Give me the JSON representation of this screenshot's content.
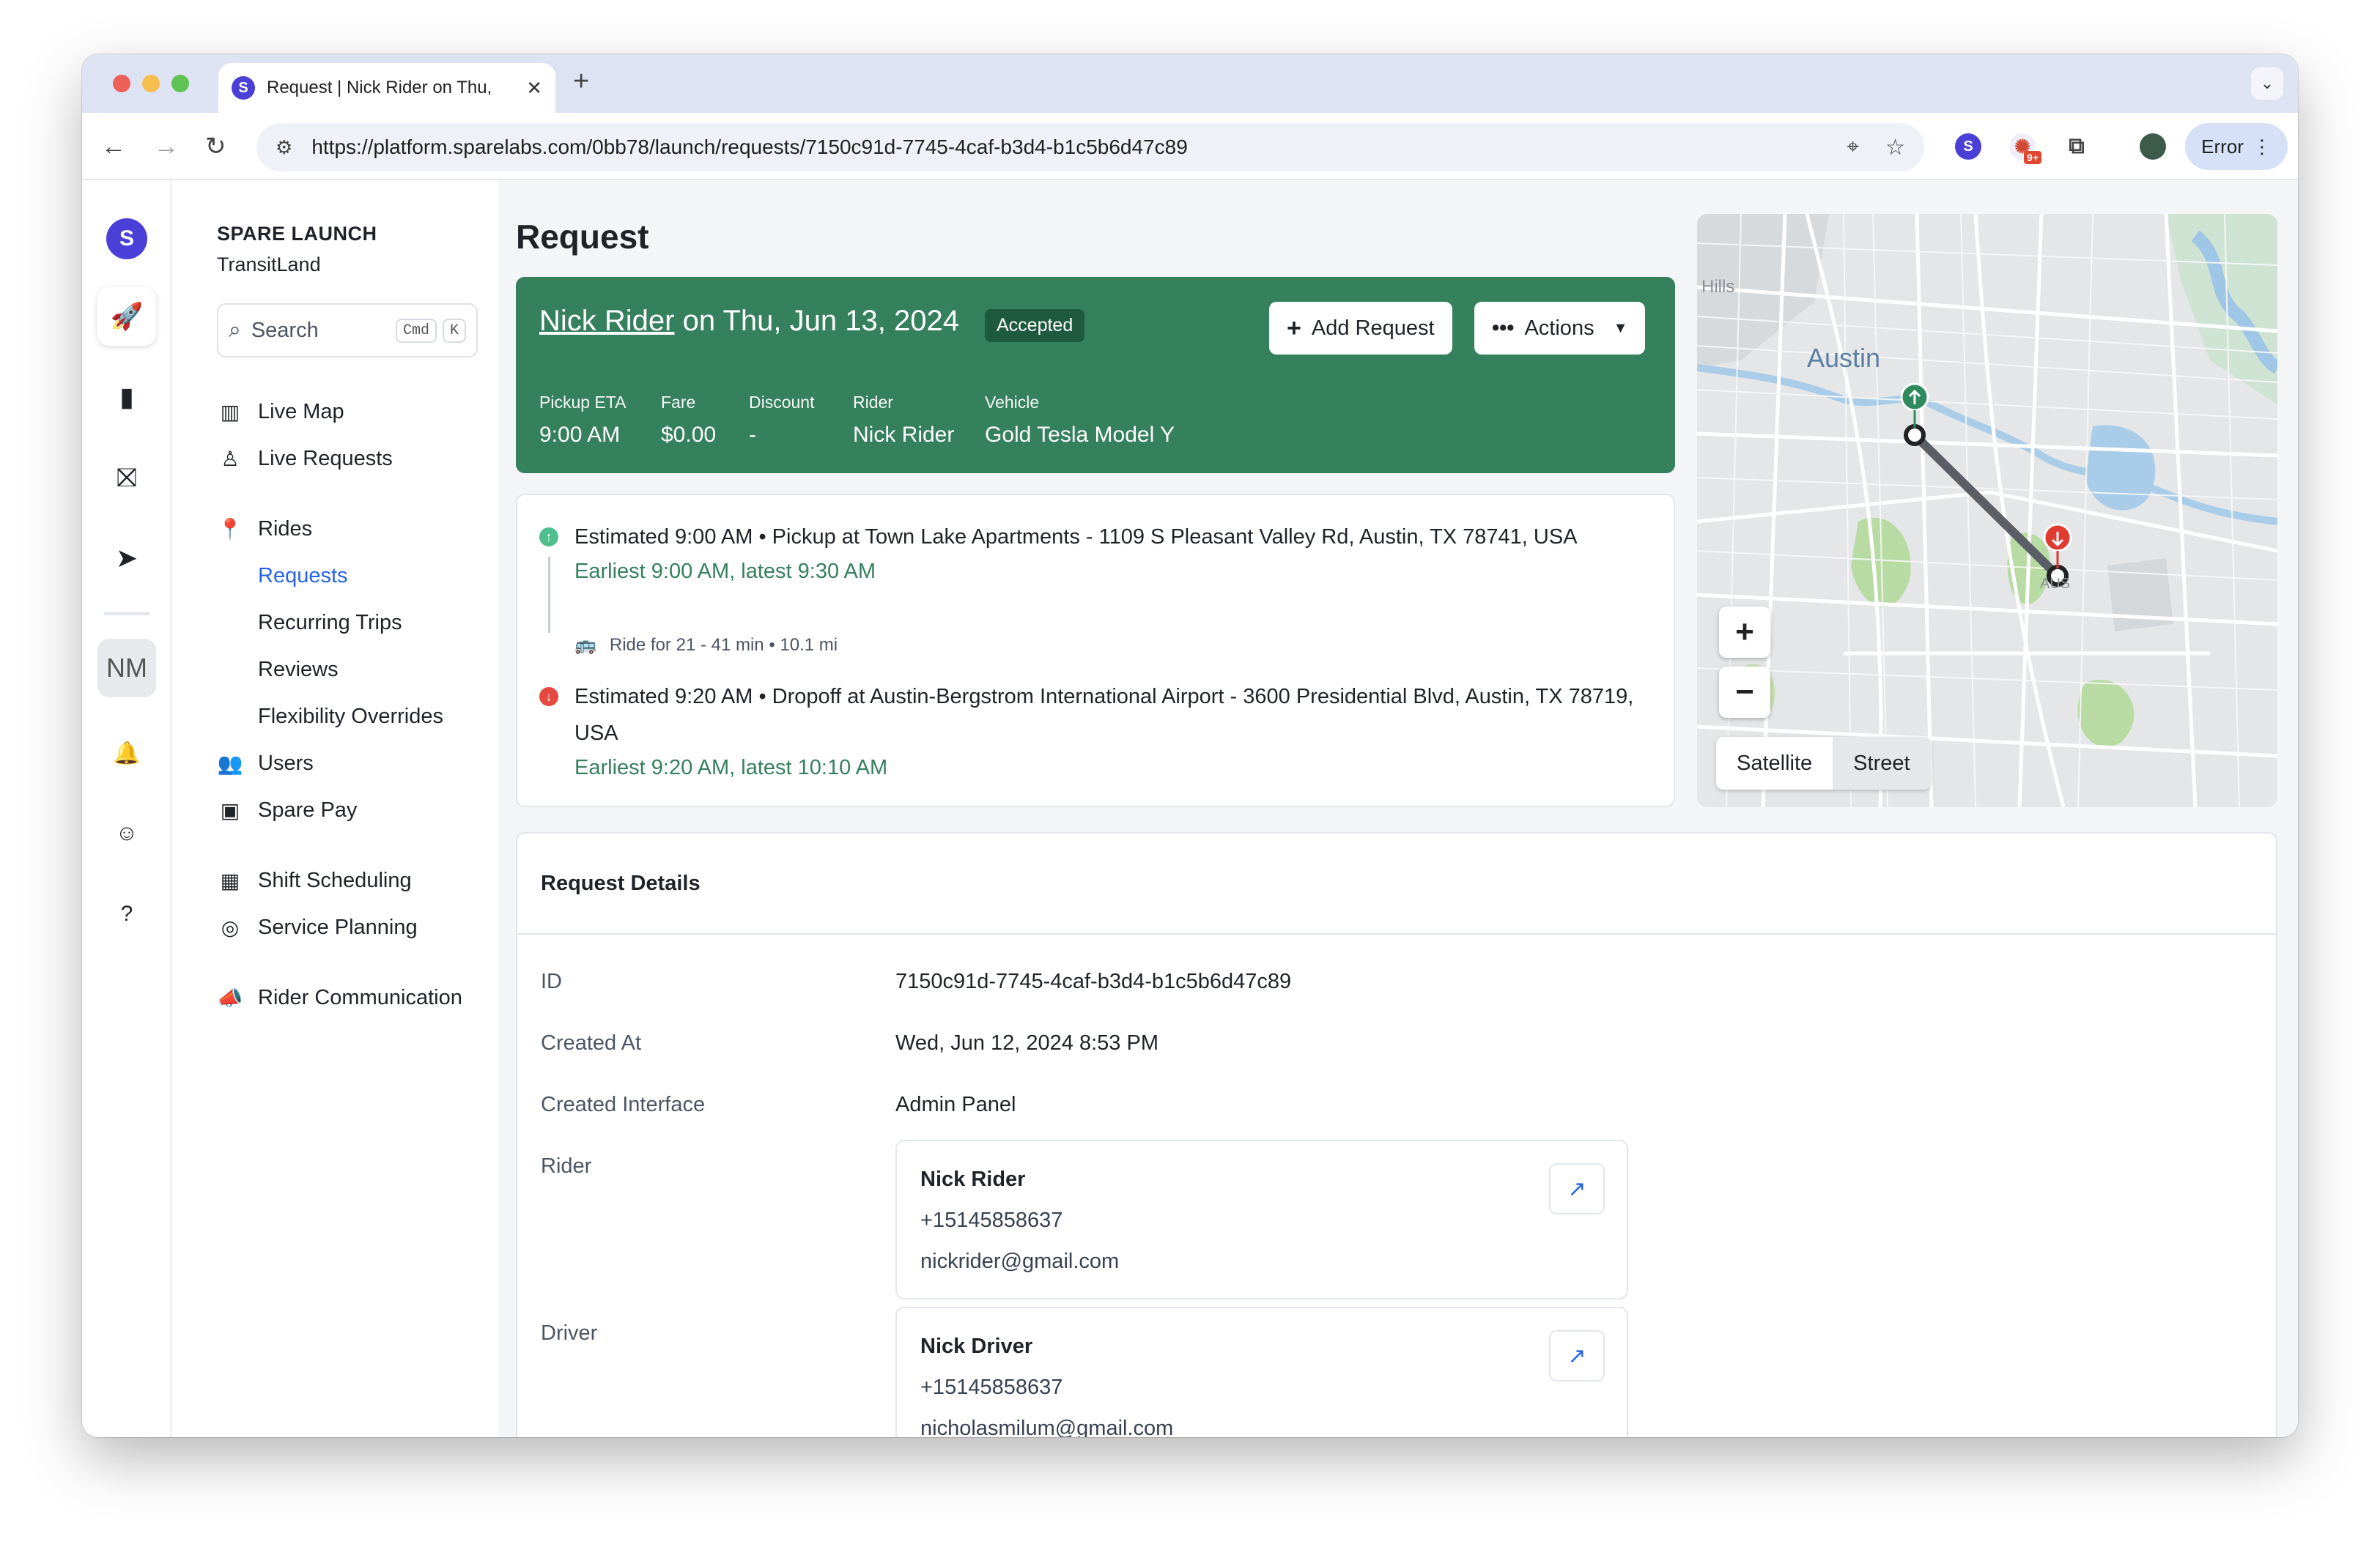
{
  "browser": {
    "tab_title": "Request | Nick Rider on Thu,",
    "tab_favicon": "S",
    "new_tab": "+",
    "url": "https://platform.sparelabs.com/0bb78/launch/requests/7150c91d-7745-4caf-b3d4-b1c5b6d47c89",
    "extension_badge": "9+",
    "profile_button": "Error"
  },
  "rail": {
    "logo": "S",
    "initials": "NM"
  },
  "nav": {
    "org": "SPARE LAUNCH",
    "tenant": "TransitLand",
    "search_label": "Search",
    "search_kbd1": "Cmd",
    "search_kbd2": "K",
    "live_map": "Live Map",
    "live_requests": "Live Requests",
    "rides": "Rides",
    "requests": "Requests",
    "recurring_trips": "Recurring Trips",
    "reviews": "Reviews",
    "flexibility_overrides": "Flexibility Overrides",
    "users": "Users",
    "spare_pay": "Spare Pay",
    "shift_scheduling": "Shift Scheduling",
    "service_planning": "Service Planning",
    "rider_communication": "Rider Communication"
  },
  "page": {
    "title": "Request"
  },
  "banner": {
    "rider_name": "Nick Rider",
    "date_text": " on Thu, Jun 13, 2024",
    "status": "Accepted",
    "add_request": "Add Request",
    "actions": "Actions",
    "stats": {
      "pickup_eta_label": "Pickup ETA",
      "pickup_eta": "9:00 AM",
      "fare_label": "Fare",
      "fare": "$0.00",
      "discount_label": "Discount",
      "discount": "-",
      "rider_label": "Rider",
      "rider": "Nick Rider",
      "vehicle_label": "Vehicle",
      "vehicle": "Gold Tesla Model Y"
    },
    "color": "#35805d"
  },
  "itinerary": {
    "pickup": "Estimated 9:00 AM  •  Pickup at Town Lake Apartments - 1109 S Pleasant Valley Rd, Austin, TX 78741, USA",
    "pickup_window": "Earliest 9:00 AM, latest 9:30 AM",
    "ride_info": "Ride for 21 - 41 min  •  10.1 mi",
    "dropoff": "Estimated 9:20 AM  •  Dropoff at Austin-Bergstrom International Airport - 3600 Presidential Blvd, Austin, TX 78719, USA",
    "dropoff_window": "Earliest 9:20 AM, latest 10:10 AM"
  },
  "map": {
    "city_label": "Austin",
    "hills_label": "Hills",
    "airport_label": "AUS",
    "zoom_in": "+",
    "zoom_out": "−",
    "satellite": "Satellite",
    "street": "Street"
  },
  "details": {
    "heading": "Request Details",
    "id_label": "ID",
    "id": "7150c91d-7745-4caf-b3d4-b1c5b6d47c89",
    "created_at_label": "Created At",
    "created_at": "Wed, Jun 12, 2024 8:53 PM",
    "interface_label": "Created Interface",
    "interface": "Admin Panel",
    "rider_label": "Rider",
    "rider": {
      "name": "Nick Rider",
      "phone": "+15145858637",
      "email": "nickrider@gmail.com"
    },
    "driver_label": "Driver",
    "driver": {
      "name": "Nick Driver",
      "phone": "+15145858637",
      "email": "nicholasmilum@gmail.com"
    }
  }
}
